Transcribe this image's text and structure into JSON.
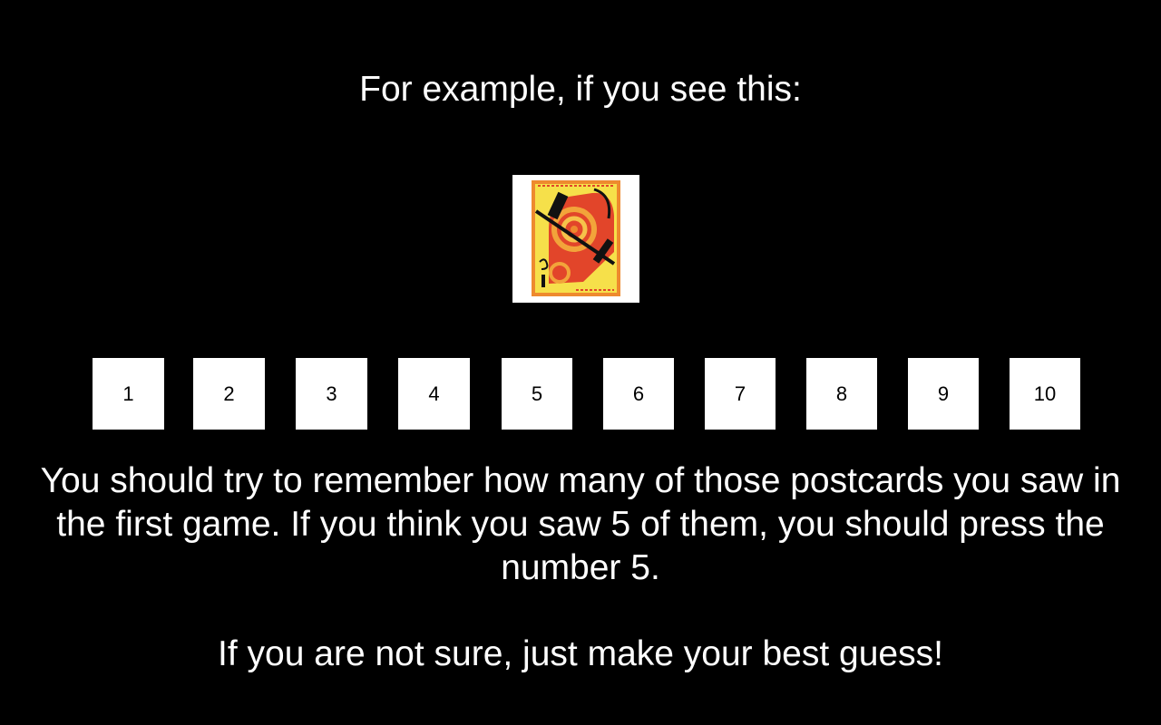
{
  "heading": "For example, if you see this:",
  "example_card": {
    "icon": "abstract-postcard-image",
    "colors": {
      "background": "#ffffff",
      "card_yellow": "#f6e04a",
      "card_orange": "#ee8a2e",
      "card_red": "#e2452a",
      "ink": "#111111"
    }
  },
  "choices": [
    "1",
    "2",
    "3",
    "4",
    "5",
    "6",
    "7",
    "8",
    "9",
    "10"
  ],
  "instructions": "You should try to remember how many of those postcards you saw in the first game. If you think you saw 5 of them, you should press the number 5.",
  "encouragement": "If you are not sure, just make your best guess!"
}
